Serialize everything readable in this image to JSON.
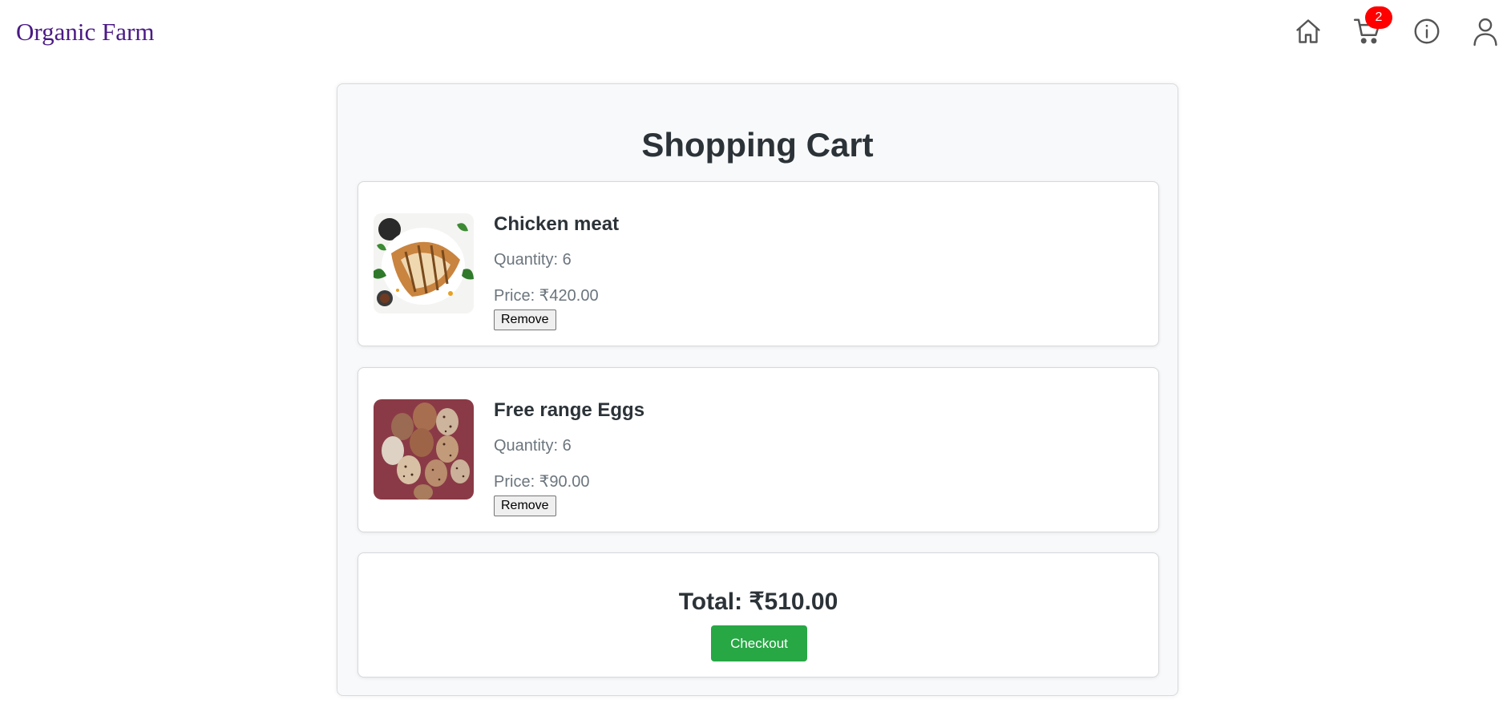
{
  "header": {
    "brand": "Organic Farm",
    "cart_count": "2",
    "icons": [
      "home-icon",
      "cart-icon",
      "info-icon",
      "user-icon"
    ]
  },
  "cart": {
    "title": "Shopping Cart",
    "items": [
      {
        "name": "Chicken meat",
        "quantity": "Quantity: 6",
        "price": "Price: ₹420.00",
        "remove_label": "Remove"
      },
      {
        "name": "Free range Eggs",
        "quantity": "Quantity: 6",
        "price": "Price: ₹90.00",
        "remove_label": "Remove"
      }
    ],
    "total": "Total: ₹510.00",
    "checkout_label": "Checkout"
  },
  "colors": {
    "brand": "#4b1a86",
    "badge": "#ff0000",
    "checkout": "#28a745",
    "panel_bg": "#f8f9fa"
  }
}
